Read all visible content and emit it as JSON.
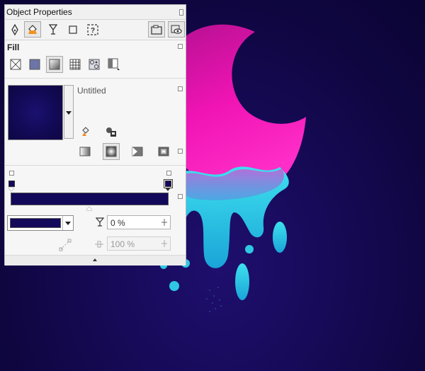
{
  "panel": {
    "title": "Object Properties",
    "tabs": [
      {
        "icon": "pen-nib-icon"
      },
      {
        "icon": "fill-bucket-icon",
        "active": true
      },
      {
        "icon": "transparency-glass-icon"
      },
      {
        "icon": "square-outline-icon"
      },
      {
        "icon": "summary-question-icon"
      }
    ],
    "tab_right_icons": [
      "frame-icon",
      "eye-icon"
    ]
  },
  "fill": {
    "section_title": "Fill",
    "fill_types": [
      {
        "name": "no-fill",
        "icon": "x-box-icon"
      },
      {
        "name": "uniform-fill",
        "icon": "solid-square-icon"
      },
      {
        "name": "fountain-fill",
        "icon": "gradient-square-icon",
        "selected": true
      },
      {
        "name": "vector-pattern-fill",
        "icon": "grid-pattern-icon"
      },
      {
        "name": "bitmap-pattern-fill",
        "icon": "swirl-pattern-icon"
      },
      {
        "name": "two-color-fill",
        "icon": "two-color-icon"
      }
    ],
    "preset_name": "Untitled",
    "fountain_types": [
      {
        "name": "linear",
        "icon": "linear-gradient-icon"
      },
      {
        "name": "elliptical",
        "icon": "elliptical-gradient-icon",
        "selected": true
      },
      {
        "name": "conical",
        "icon": "conical-gradient-icon"
      },
      {
        "name": "rectangular",
        "icon": "rectangular-gradient-icon"
      }
    ],
    "transparency_value": "0 %",
    "midpoint_value": "100 %",
    "colors": {
      "start_node": "#14095c",
      "end_node": "#14095c",
      "ramp": "#12095a",
      "canvas_dark": "#0f0640",
      "moon_pink": "#ff18b8",
      "drip_cyan": "#2ad0e0"
    }
  }
}
